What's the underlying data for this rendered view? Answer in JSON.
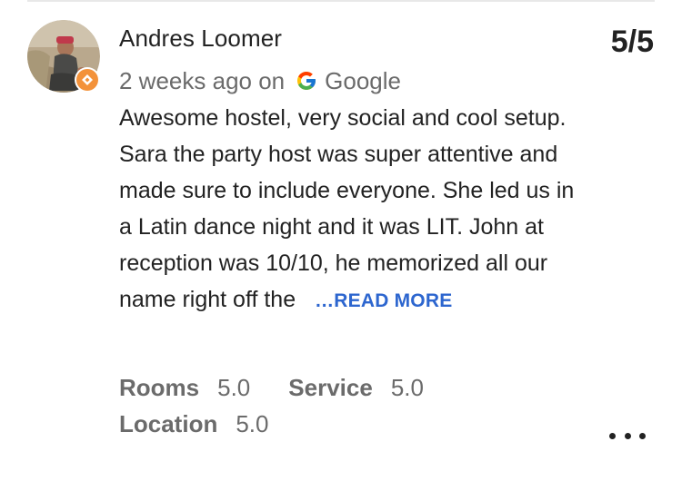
{
  "review": {
    "author": "Andres Loomer",
    "score": "5/5",
    "time": "2 weeks ago on",
    "source": "Google",
    "text": "Awesome hostel, very social and cool setup. Sara the party host was super attentive and made sure to include everyone. She led us in a Latin dance night and it was LIT. John at reception was 10/10, he memorized all our name right off the ",
    "read_more": "…READ MORE",
    "ratings": [
      {
        "label": "Rooms",
        "value": "5.0"
      },
      {
        "label": "Service",
        "value": "5.0"
      },
      {
        "label": "Location",
        "value": "5.0"
      }
    ]
  },
  "colors": {
    "link": "#2d66cf",
    "badge": "#f3923a",
    "muted": "#6b6b6b"
  },
  "icons": {
    "badge": "local-guide-badge-icon",
    "source": "google-g-icon",
    "more": "more-options-icon"
  }
}
